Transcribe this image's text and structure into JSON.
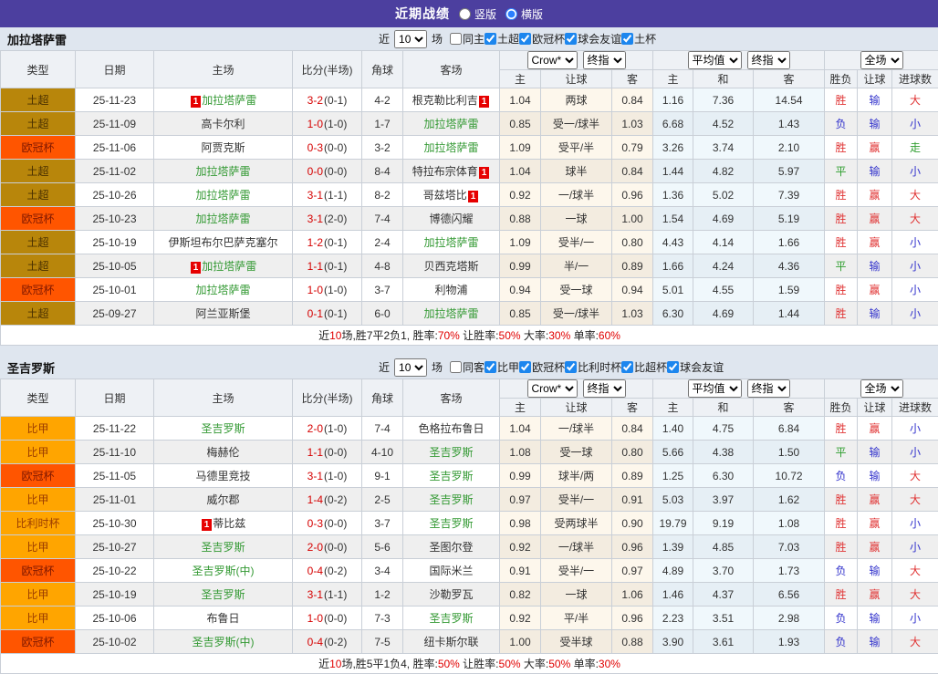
{
  "header": {
    "title": "近期战绩",
    "layout_options": [
      {
        "label": "竖版",
        "selected": false
      },
      {
        "label": "横版",
        "selected": true
      }
    ]
  },
  "colors": {
    "header_bg": "#4c3f9f",
    "page_bg": "#dfe6ef",
    "team_green": "#339933",
    "score_red": "#d50000",
    "badge_bg": "#e60000",
    "summary_red": "#e00000",
    "result": {
      "red": "#e03333",
      "blue": "#3333cc",
      "green": "#2f9e2f"
    },
    "type_styles": {
      "土超": {
        "bg": "#b8860b",
        "fg": "#4a3000"
      },
      "欧冠杯": {
        "bg": "#ff5500",
        "fg": "#7e1800"
      },
      "比甲": {
        "bg": "#ffa500",
        "fg": "#9c3d00"
      },
      "比利时杯": {
        "bg": "#ffa500",
        "fg": "#9c3d00"
      }
    }
  },
  "shared": {
    "near_label": "近",
    "games_label": "场",
    "columns": [
      "类型",
      "日期",
      "主场",
      "比分(半场)",
      "角球",
      "客场"
    ],
    "sub_columns": [
      "主",
      "让球",
      "客",
      "主",
      "和",
      "客",
      "胜负",
      "让球",
      "进球数"
    ],
    "dropdowns": {
      "crow": "Crow*",
      "final1": "终指",
      "avg": "平均值",
      "final2": "终指",
      "scope": "全场"
    }
  },
  "tables": [
    {
      "team": "加拉塔萨雷",
      "games": "10",
      "same_venue": {
        "label": "同主",
        "checked": false
      },
      "leagues": [
        {
          "label": "土超",
          "checked": true
        },
        {
          "label": "欧冠杯",
          "checked": true
        },
        {
          "label": "球会友谊",
          "checked": true
        },
        {
          "label": "土杯",
          "checked": true
        }
      ],
      "rows": [
        {
          "type": "土超",
          "date": "25-11-23",
          "home": {
            "badge": "1",
            "name": "加拉塔萨雷",
            "self": true
          },
          "score": "3-2",
          "half": "(0-1)",
          "corner": "4-2",
          "away": {
            "name": "根克勒比利吉",
            "badge": "1",
            "self": false
          },
          "odds": [
            "1.04",
            "两球",
            "0.84"
          ],
          "avg": [
            "1.16",
            "7.36",
            "14.54"
          ],
          "res": [
            "胜",
            "输",
            "大"
          ]
        },
        {
          "type": "土超",
          "date": "25-11-09",
          "home": {
            "name": "高卡尔利",
            "self": false
          },
          "score": "1-0",
          "half": "(1-0)",
          "corner": "1-7",
          "away": {
            "name": "加拉塔萨雷",
            "self": true
          },
          "odds": [
            "0.85",
            "受一/球半",
            "1.03"
          ],
          "avg": [
            "6.68",
            "4.52",
            "1.43"
          ],
          "res": [
            "负",
            "输",
            "小"
          ]
        },
        {
          "type": "欧冠杯",
          "date": "25-11-06",
          "home": {
            "name": "阿贾克斯",
            "self": false
          },
          "score": "0-3",
          "half": "(0-0)",
          "corner": "3-2",
          "away": {
            "name": "加拉塔萨雷",
            "self": true
          },
          "odds": [
            "1.09",
            "受平/半",
            "0.79"
          ],
          "avg": [
            "3.26",
            "3.74",
            "2.10"
          ],
          "res": [
            "胜",
            "赢",
            "走"
          ]
        },
        {
          "type": "土超",
          "date": "25-11-02",
          "home": {
            "name": "加拉塔萨雷",
            "self": true
          },
          "score": "0-0",
          "half": "(0-0)",
          "corner": "8-4",
          "away": {
            "name": "特拉布宗体育",
            "badge": "1",
            "self": false
          },
          "odds": [
            "1.04",
            "球半",
            "0.84"
          ],
          "avg": [
            "1.44",
            "4.82",
            "5.97"
          ],
          "res": [
            "平",
            "输",
            "小"
          ]
        },
        {
          "type": "土超",
          "date": "25-10-26",
          "home": {
            "name": "加拉塔萨雷",
            "self": true
          },
          "score": "3-1",
          "half": "(1-1)",
          "corner": "8-2",
          "away": {
            "name": "哥兹塔比",
            "badge": "1",
            "self": false
          },
          "odds": [
            "0.92",
            "一/球半",
            "0.96"
          ],
          "avg": [
            "1.36",
            "5.02",
            "7.39"
          ],
          "res": [
            "胜",
            "赢",
            "大"
          ]
        },
        {
          "type": "欧冠杯",
          "date": "25-10-23",
          "home": {
            "name": "加拉塔萨雷",
            "self": true
          },
          "score": "3-1",
          "half": "(2-0)",
          "corner": "7-4",
          "away": {
            "name": "博德闪耀",
            "self": false
          },
          "odds": [
            "0.88",
            "一球",
            "1.00"
          ],
          "avg": [
            "1.54",
            "4.69",
            "5.19"
          ],
          "res": [
            "胜",
            "赢",
            "大"
          ]
        },
        {
          "type": "土超",
          "date": "25-10-19",
          "home": {
            "name": "伊斯坦布尔巴萨克塞尔",
            "self": false
          },
          "score": "1-2",
          "half": "(0-1)",
          "corner": "2-4",
          "away": {
            "name": "加拉塔萨雷",
            "self": true
          },
          "odds": [
            "1.09",
            "受半/一",
            "0.80"
          ],
          "avg": [
            "4.43",
            "4.14",
            "1.66"
          ],
          "res": [
            "胜",
            "赢",
            "小"
          ]
        },
        {
          "type": "土超",
          "date": "25-10-05",
          "home": {
            "badge": "1",
            "name": "加拉塔萨雷",
            "self": true
          },
          "score": "1-1",
          "half": "(0-1)",
          "corner": "4-8",
          "away": {
            "name": "贝西克塔斯",
            "self": false
          },
          "odds": [
            "0.99",
            "半/一",
            "0.89"
          ],
          "avg": [
            "1.66",
            "4.24",
            "4.36"
          ],
          "res": [
            "平",
            "输",
            "小"
          ]
        },
        {
          "type": "欧冠杯",
          "date": "25-10-01",
          "home": {
            "name": "加拉塔萨雷",
            "self": true
          },
          "score": "1-0",
          "half": "(1-0)",
          "corner": "3-7",
          "away": {
            "name": "利物浦",
            "self": false
          },
          "odds": [
            "0.94",
            "受一球",
            "0.94"
          ],
          "avg": [
            "5.01",
            "4.55",
            "1.59"
          ],
          "res": [
            "胜",
            "赢",
            "小"
          ]
        },
        {
          "type": "土超",
          "date": "25-09-27",
          "home": {
            "name": "阿兰亚斯堡",
            "self": false
          },
          "score": "0-1",
          "half": "(0-1)",
          "corner": "6-0",
          "away": {
            "name": "加拉塔萨雷",
            "self": true
          },
          "odds": [
            "0.85",
            "受一/球半",
            "1.03"
          ],
          "avg": [
            "6.30",
            "4.69",
            "1.44"
          ],
          "res": [
            "胜",
            "输",
            "小"
          ]
        }
      ],
      "summary": [
        {
          "t": "近"
        },
        {
          "t": "10",
          "red": true
        },
        {
          "t": "场,胜7平2负1, 胜率:"
        },
        {
          "t": "70%",
          "red": true
        },
        {
          "t": " 让胜率:"
        },
        {
          "t": "50%",
          "red": true
        },
        {
          "t": " 大率:"
        },
        {
          "t": "30%",
          "red": true
        },
        {
          "t": " 单率:"
        },
        {
          "t": "60%",
          "red": true
        }
      ]
    },
    {
      "team": "圣吉罗斯",
      "games": "10",
      "same_venue": {
        "label": "同客",
        "checked": false
      },
      "leagues": [
        {
          "label": "比甲",
          "checked": true
        },
        {
          "label": "欧冠杯",
          "checked": true
        },
        {
          "label": "比利时杯",
          "checked": true
        },
        {
          "label": "比超杯",
          "checked": true
        },
        {
          "label": "球会友谊",
          "checked": true
        }
      ],
      "rows": [
        {
          "type": "比甲",
          "date": "25-11-22",
          "home": {
            "name": "圣吉罗斯",
            "self": true
          },
          "score": "2-0",
          "half": "(1-0)",
          "corner": "7-4",
          "away": {
            "name": "色格拉布鲁日",
            "self": false
          },
          "odds": [
            "1.04",
            "一/球半",
            "0.84"
          ],
          "avg": [
            "1.40",
            "4.75",
            "6.84"
          ],
          "res": [
            "胜",
            "赢",
            "小"
          ]
        },
        {
          "type": "比甲",
          "date": "25-11-10",
          "home": {
            "name": "梅赫伦",
            "self": false
          },
          "score": "1-1",
          "half": "(0-0)",
          "corner": "4-10",
          "away": {
            "name": "圣吉罗斯",
            "self": true
          },
          "odds": [
            "1.08",
            "受一球",
            "0.80"
          ],
          "avg": [
            "5.66",
            "4.38",
            "1.50"
          ],
          "res": [
            "平",
            "输",
            "小"
          ]
        },
        {
          "type": "欧冠杯",
          "date": "25-11-05",
          "home": {
            "name": "马德里竞技",
            "self": false
          },
          "score": "3-1",
          "half": "(1-0)",
          "corner": "9-1",
          "away": {
            "name": "圣吉罗斯",
            "self": true
          },
          "odds": [
            "0.99",
            "球半/两",
            "0.89"
          ],
          "avg": [
            "1.25",
            "6.30",
            "10.72"
          ],
          "res": [
            "负",
            "输",
            "大"
          ]
        },
        {
          "type": "比甲",
          "date": "25-11-01",
          "home": {
            "name": "威尔郡",
            "self": false
          },
          "score": "1-4",
          "half": "(0-2)",
          "corner": "2-5",
          "away": {
            "name": "圣吉罗斯",
            "self": true
          },
          "odds": [
            "0.97",
            "受半/一",
            "0.91"
          ],
          "avg": [
            "5.03",
            "3.97",
            "1.62"
          ],
          "res": [
            "胜",
            "赢",
            "大"
          ]
        },
        {
          "type": "比利时杯",
          "date": "25-10-30",
          "home": {
            "badge": "1",
            "name": "蒂比兹",
            "self": false
          },
          "score": "0-3",
          "half": "(0-0)",
          "corner": "3-7",
          "away": {
            "name": "圣吉罗斯",
            "self": true
          },
          "odds": [
            "0.98",
            "受两球半",
            "0.90"
          ],
          "avg": [
            "19.79",
            "9.19",
            "1.08"
          ],
          "res": [
            "胜",
            "赢",
            "小"
          ]
        },
        {
          "type": "比甲",
          "date": "25-10-27",
          "home": {
            "name": "圣吉罗斯",
            "self": true
          },
          "score": "2-0",
          "half": "(0-0)",
          "corner": "5-6",
          "away": {
            "name": "圣图尔登",
            "self": false
          },
          "odds": [
            "0.92",
            "一/球半",
            "0.96"
          ],
          "avg": [
            "1.39",
            "4.85",
            "7.03"
          ],
          "res": [
            "胜",
            "赢",
            "小"
          ]
        },
        {
          "type": "欧冠杯",
          "date": "25-10-22",
          "home": {
            "name": "圣吉罗斯(中)",
            "self": true
          },
          "score": "0-4",
          "half": "(0-2)",
          "corner": "3-4",
          "away": {
            "name": "国际米兰",
            "self": false
          },
          "odds": [
            "0.91",
            "受半/一",
            "0.97"
          ],
          "avg": [
            "4.89",
            "3.70",
            "1.73"
          ],
          "res": [
            "负",
            "输",
            "大"
          ]
        },
        {
          "type": "比甲",
          "date": "25-10-19",
          "home": {
            "name": "圣吉罗斯",
            "self": true
          },
          "score": "3-1",
          "half": "(1-1)",
          "corner": "1-2",
          "away": {
            "name": "沙勒罗瓦",
            "self": false
          },
          "odds": [
            "0.82",
            "一球",
            "1.06"
          ],
          "avg": [
            "1.46",
            "4.37",
            "6.56"
          ],
          "res": [
            "胜",
            "赢",
            "大"
          ]
        },
        {
          "type": "比甲",
          "date": "25-10-06",
          "home": {
            "name": "布鲁日",
            "self": false
          },
          "score": "1-0",
          "half": "(0-0)",
          "corner": "7-3",
          "away": {
            "name": "圣吉罗斯",
            "self": true
          },
          "odds": [
            "0.92",
            "平/半",
            "0.96"
          ],
          "avg": [
            "2.23",
            "3.51",
            "2.98"
          ],
          "res": [
            "负",
            "输",
            "小"
          ]
        },
        {
          "type": "欧冠杯",
          "date": "25-10-02",
          "home": {
            "name": "圣吉罗斯(中)",
            "self": true
          },
          "score": "0-4",
          "half": "(0-2)",
          "corner": "7-5",
          "away": {
            "name": "纽卡斯尔联",
            "self": false
          },
          "odds": [
            "1.00",
            "受半球",
            "0.88"
          ],
          "avg": [
            "3.90",
            "3.61",
            "1.93"
          ],
          "res": [
            "负",
            "输",
            "大"
          ]
        }
      ],
      "summary": [
        {
          "t": "近"
        },
        {
          "t": "10",
          "red": true
        },
        {
          "t": "场,胜5平1负4, 胜率:"
        },
        {
          "t": "50%",
          "red": true
        },
        {
          "t": " 让胜率:"
        },
        {
          "t": "50%",
          "red": true
        },
        {
          "t": " 大率:"
        },
        {
          "t": "50%",
          "red": true
        },
        {
          "t": " 单率:"
        },
        {
          "t": "30%",
          "red": true
        }
      ]
    }
  ]
}
